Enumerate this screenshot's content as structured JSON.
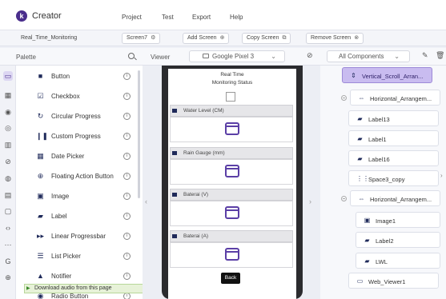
{
  "app": {
    "logo_letter": "k",
    "name": "Creator"
  },
  "menu": [
    "Project",
    "Test",
    "Export",
    "Help"
  ],
  "toolbar": {
    "project_name": "Real_Time_Monitoring",
    "screen_button": "Screen7",
    "add_screen": "Add Screen",
    "copy_screen": "Copy Screen",
    "remove_screen": "Remove Screen"
  },
  "palette": {
    "title": "Palette",
    "items": [
      {
        "label": "Button",
        "icon": "button-icon"
      },
      {
        "label": "Checkbox",
        "icon": "checkbox-icon"
      },
      {
        "label": "Circular Progress",
        "icon": "circular-progress-icon"
      },
      {
        "label": "Custom Progress",
        "icon": "custom-progress-icon"
      },
      {
        "label": "Date Picker",
        "icon": "date-picker-icon"
      },
      {
        "label": "Floating Action Button",
        "icon": "fab-icon"
      },
      {
        "label": "Image",
        "icon": "image-icon"
      },
      {
        "label": "Label",
        "icon": "label-icon"
      },
      {
        "label": "Linear Progressbar",
        "icon": "linear-progress-icon"
      },
      {
        "label": "List Picker",
        "icon": "list-picker-icon"
      },
      {
        "label": "Notifier",
        "icon": "notifier-icon"
      },
      {
        "label": "Radio Button",
        "icon": "radio-button-icon"
      }
    ],
    "download_bar": "Download audio from this page"
  },
  "viewer": {
    "title": "Viewer",
    "device": "Google Pixel 3",
    "screen": {
      "title_line1": "Real Time",
      "title_line2": "Monitoring Status",
      "sections": [
        "Water Level (CM)",
        "Rain Gauge (mm)",
        "Baterai (V)",
        "Baterai (A)"
      ],
      "back_button": "Back"
    }
  },
  "components": {
    "dropdown": "All Components",
    "tree": [
      {
        "label": "Vertical_Scroll_Arran...",
        "icon": "vertical-arrangement-icon",
        "selected": true
      },
      {
        "label": "Horizontal_Arrangem...",
        "icon": "horizontal-arrangement-icon"
      },
      {
        "label": "Label13",
        "icon": "label-icon"
      },
      {
        "label": "Label1",
        "icon": "label-icon"
      },
      {
        "label": "Label16",
        "icon": "label-icon"
      },
      {
        "label": "Space3_copy",
        "icon": "space-icon"
      },
      {
        "label": "Horizontal_Arrangem...",
        "icon": "horizontal-arrangement-icon"
      },
      {
        "label": "Image1",
        "icon": "image-icon"
      },
      {
        "label": "Label2",
        "icon": "label-icon"
      },
      {
        "label": "LWL",
        "icon": "label-icon"
      },
      {
        "label": "Web_Viewer1",
        "icon": "web-viewer-icon"
      }
    ]
  },
  "colors": {
    "accent": "#4a2e8c",
    "selected": "#c9bcf0",
    "icon": "#1f2a5a",
    "webviewer": "#5b3fa6"
  }
}
